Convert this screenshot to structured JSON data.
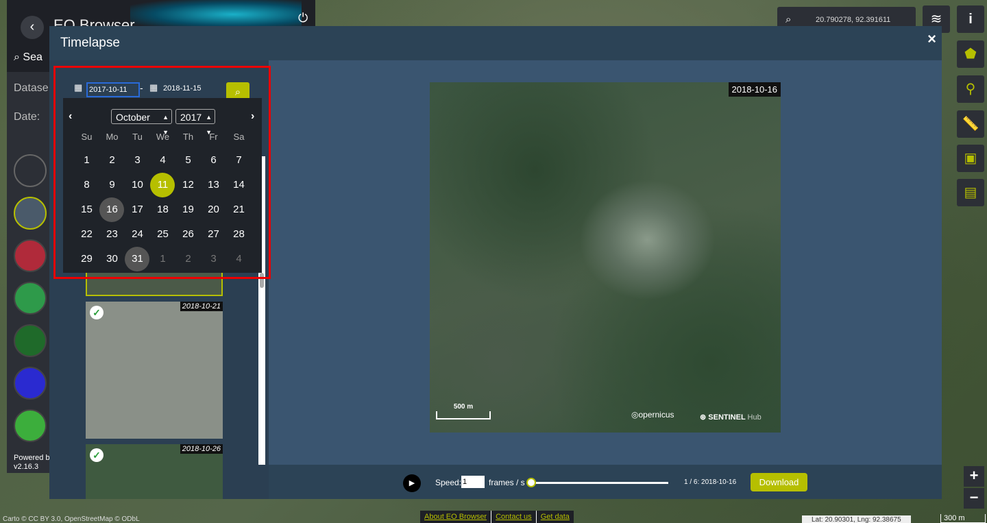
{
  "map": {
    "coords": "20.790278, 92.391611",
    "attribution": "Carto © CC BY 3.0, OpenStreetMap © ODbL",
    "footer_links": [
      "About EO Browser",
      "Contact us",
      "Get data"
    ],
    "latlng": "Lat: 20.90301, Lng: 92.38675",
    "scale": "300 m"
  },
  "sidebar": {
    "brand": "EO Browser",
    "search_label": "Sea",
    "dataset_label": "Datase",
    "date_label": "Date:",
    "powered": "Powered b",
    "version": "v2.16.3"
  },
  "modal": {
    "title": "Timelapse",
    "close": "×"
  },
  "dates": {
    "from": "2017-10-11",
    "to": "2018-11-15"
  },
  "calendar": {
    "month": "October",
    "year": "2017",
    "weekdays": [
      "Su",
      "Mo",
      "Tu",
      "We",
      "Th",
      "Fr",
      "Sa"
    ],
    "weeks": [
      [
        "1",
        "2",
        "3",
        "4",
        "5",
        "6",
        "7"
      ],
      [
        "8",
        "9",
        "10",
        "11",
        "12",
        "13",
        "14"
      ],
      [
        "15",
        "16",
        "17",
        "18",
        "19",
        "20",
        "21"
      ],
      [
        "22",
        "23",
        "24",
        "25",
        "26",
        "27",
        "28"
      ],
      [
        "29",
        "30",
        "31",
        "1",
        "2",
        "3",
        "4"
      ]
    ],
    "selected": "11",
    "highlighted": [
      "16",
      "31"
    ],
    "selected_color": "#b6bf00",
    "highlight_color": "#555555"
  },
  "thumbnails": [
    {
      "date": "2018-10-21",
      "checked": true
    },
    {
      "date": "2018-10-26",
      "checked": true
    }
  ],
  "preview": {
    "date": "2018-10-16",
    "scale": "500 m",
    "logo_copernicus": "opernicus",
    "logo_sentinel": "SENTINEL",
    "logo_hub": "Hub"
  },
  "player": {
    "speed_label": "Speed:",
    "speed_value": "1",
    "fps_label": "frames / s",
    "frame_info": "1 / 6: 2018-10-16",
    "download": "Download"
  },
  "colors": {
    "accent": "#b6bf00",
    "modal_bg": "#2b3f52",
    "highlight_box": "#e00000"
  }
}
